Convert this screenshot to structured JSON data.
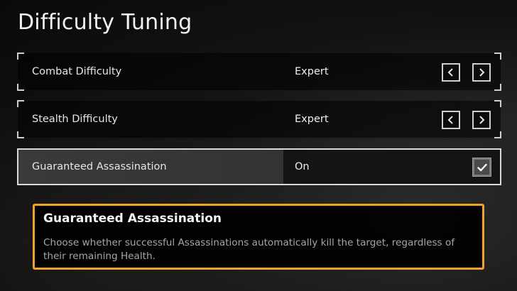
{
  "page": {
    "title": "Difficulty Tuning"
  },
  "settings": [
    {
      "label": "Combat Difficulty",
      "value": "Expert",
      "control": "arrows"
    },
    {
      "label": "Stealth Difficulty",
      "value": "Expert",
      "control": "arrows"
    },
    {
      "label": "Guaranteed Assassination",
      "value": "On",
      "control": "checkbox",
      "checked": true,
      "selected": true
    }
  ],
  "info": {
    "title": "Guaranteed Assassination",
    "description": "Choose whether successful Assassinations automatically kill the target, regardless of their remaining Health."
  },
  "icons": {
    "arrow_left": "chevron-left-icon",
    "arrow_right": "chevron-right-icon",
    "check": "check-icon"
  },
  "colors": {
    "accent": "#f2a12a",
    "text": "#e9e9e9",
    "muted_text": "#a6a6a6",
    "selected_border": "#d9d9d9"
  }
}
